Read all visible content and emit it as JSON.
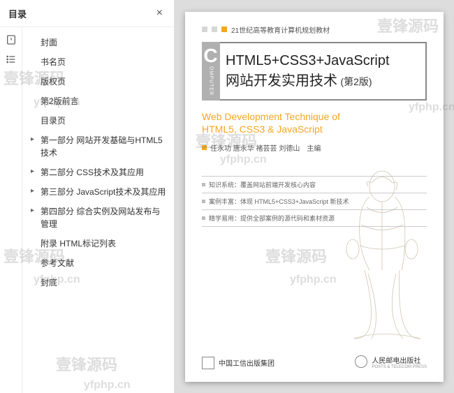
{
  "sidebar": {
    "title": "目录",
    "close_label": "×",
    "items": [
      {
        "label": "封面",
        "expandable": false
      },
      {
        "label": "书名页",
        "expandable": false
      },
      {
        "label": "版权页",
        "expandable": false
      },
      {
        "label": "第2版前言",
        "expandable": false
      },
      {
        "label": "目录页",
        "expandable": false
      },
      {
        "label": "第一部分 网站开发基础与HTML5技术",
        "expandable": true
      },
      {
        "label": "第二部分 CSS技术及其应用",
        "expandable": true
      },
      {
        "label": "第三部分 JavaScript技术及其应用",
        "expandable": true
      },
      {
        "label": "第四部分 综合实例及网站发布与管理",
        "expandable": true
      },
      {
        "label": "附录 HTML标记列表",
        "expandable": false
      },
      {
        "label": "参考文献",
        "expandable": false
      },
      {
        "label": "封底",
        "expandable": false
      }
    ]
  },
  "cover": {
    "series": "21世纪高等教育计算机规划教材",
    "tab_big": "C",
    "tab_text": "OMPUTER",
    "title_line1": "HTML5+CSS3+JavaScript",
    "title_line2": "网站开发实用技术",
    "edition": "(第2版)",
    "subtitle_line1": "Web Development Technique of",
    "subtitle_line2": "HTML5, CSS3 & JavaScript",
    "authors": "任永功 唐永华 褚芸芸 刘德山　主编",
    "bullets": [
      "知识系统：覆盖网站前端开发核心内容",
      "案例丰富：体现 HTML5+CSS3+JavaScript 新技术",
      "精学易用：提供全部案例的源代码和素材资源"
    ],
    "publisher_left": "中国工信出版集团",
    "publisher_right": "人民邮电出版社",
    "publisher_right_sub": "POSTS & TELECOM PRESS"
  },
  "watermarks": {
    "cn": "壹锋源码",
    "en": "yfphp.cn"
  }
}
